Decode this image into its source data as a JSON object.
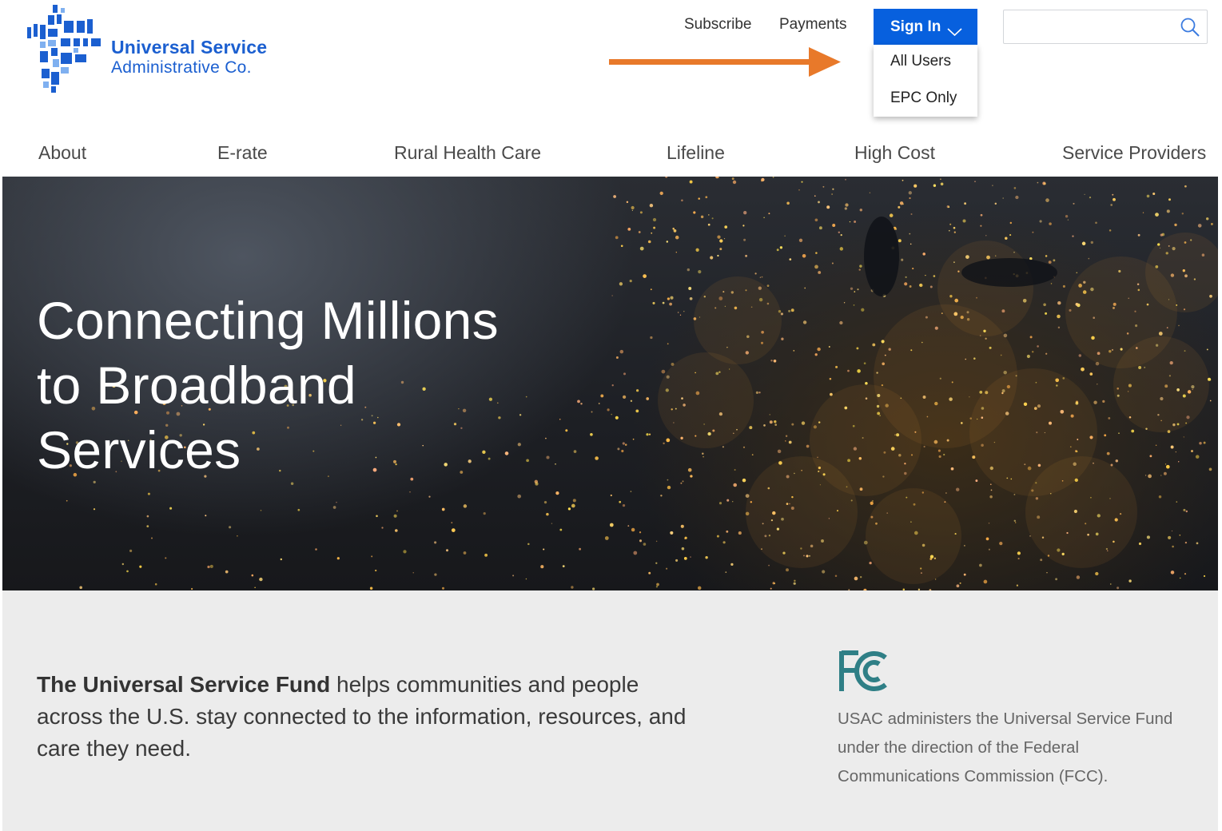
{
  "brand": {
    "name_line1": "Universal Service",
    "name_line2": "Administrative Co.",
    "color": "#1b5fd0",
    "icon": "usac-logo-mark-icon"
  },
  "utility_nav": {
    "subscribe": "Subscribe",
    "payments": "Payments"
  },
  "signin": {
    "label": "Sign In",
    "color": "#0760de",
    "expanded": true,
    "menu": [
      "All Users",
      "EPC Only"
    ]
  },
  "search": {
    "value": "",
    "icon": "search-icon"
  },
  "annotation": {
    "color": "#e8792a",
    "icon": "arrow-right-icon"
  },
  "main_nav": [
    "About",
    "E-rate",
    "Rural Health Care",
    "Lifeline",
    "High Cost",
    "Service Providers"
  ],
  "hero": {
    "title_lines": [
      "Connecting Millions",
      "to Broadband",
      "Services"
    ]
  },
  "info": {
    "lead_bold": "The Universal Service Fund",
    "lead_rest": " helps communities and people across the U.S. stay connected to the information, resources, and care they need.",
    "fcc_icon": "fcc-logo-icon",
    "fcc_text": "USAC administers the Universal Service Fund under the direction of the Federal Communications Commission (FCC)."
  }
}
